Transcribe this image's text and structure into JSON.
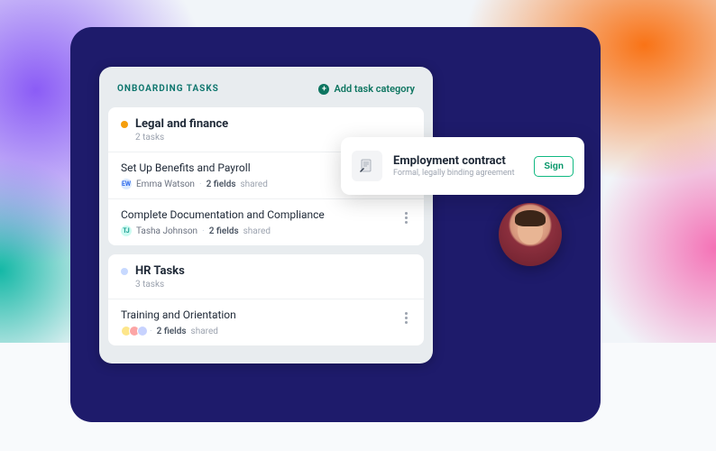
{
  "panel": {
    "title": "ONBOARDING TASKS",
    "add_label": "Add task category"
  },
  "sections": [
    {
      "dot_color": "amber",
      "title": "Legal and finance",
      "count": "2 tasks",
      "tasks": [
        {
          "title": "Set Up Benefits and Payroll",
          "assignee": "Emma Watson",
          "assignee_initials": "EW",
          "fields": "2 fields",
          "shared": "shared"
        },
        {
          "title": "Complete Documentation and Compliance",
          "assignee": "Tasha Johnson",
          "assignee_initials": "TJ",
          "fields": "2 fields",
          "shared": "shared"
        }
      ]
    },
    {
      "dot_color": "blue",
      "title": "HR Tasks",
      "count": "3 tasks",
      "tasks": [
        {
          "title": "Training and Orientation",
          "fields": "2 fields",
          "shared": "shared"
        }
      ]
    }
  ],
  "card": {
    "title": "Employment contract",
    "subtitle": "Formal, legally binding agreement",
    "button": "Sign"
  }
}
